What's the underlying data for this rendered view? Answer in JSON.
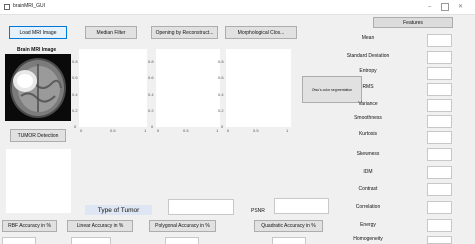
{
  "window": {
    "title": "brainMRI_GUI",
    "minimize": "–",
    "close": "✕"
  },
  "toolbar": {
    "load_mri": "Load MRI Image",
    "median_filter": "Median Filter",
    "opening": "Opening by Reconstruct...",
    "morphological": "Morphological Clos..."
  },
  "image_panel": {
    "label": "Brain MRI Image"
  },
  "axes_ticks": {
    "y": [
      "0.8",
      "0.6",
      "0.4",
      "0.2",
      "0"
    ],
    "x": [
      "0",
      "0.5",
      "1"
    ]
  },
  "segmentation_button": "Otsu’s color segmentation",
  "tumor_detection": "TUMOR Detection",
  "type_of_tumor": {
    "label": "Type of Tumor",
    "value": ""
  },
  "psnr": {
    "label": "PSNR",
    "value": ""
  },
  "accuracy": {
    "rbf": "RBF Accuracy in %",
    "linear": "Linear Accuracy in %",
    "polygonal": "Polygonal Accuracy in %",
    "quadratic": "Quadratic Accuracy in %"
  },
  "features": {
    "header": "Features",
    "items": [
      "Mean",
      "Standard Deviation",
      "Entropy",
      "RMS",
      "Variance",
      "Smoothness",
      "Kurtosis",
      "Skewness",
      "IDM",
      "Contrast",
      "Correlation",
      "Energy",
      "Homogeneity"
    ]
  }
}
